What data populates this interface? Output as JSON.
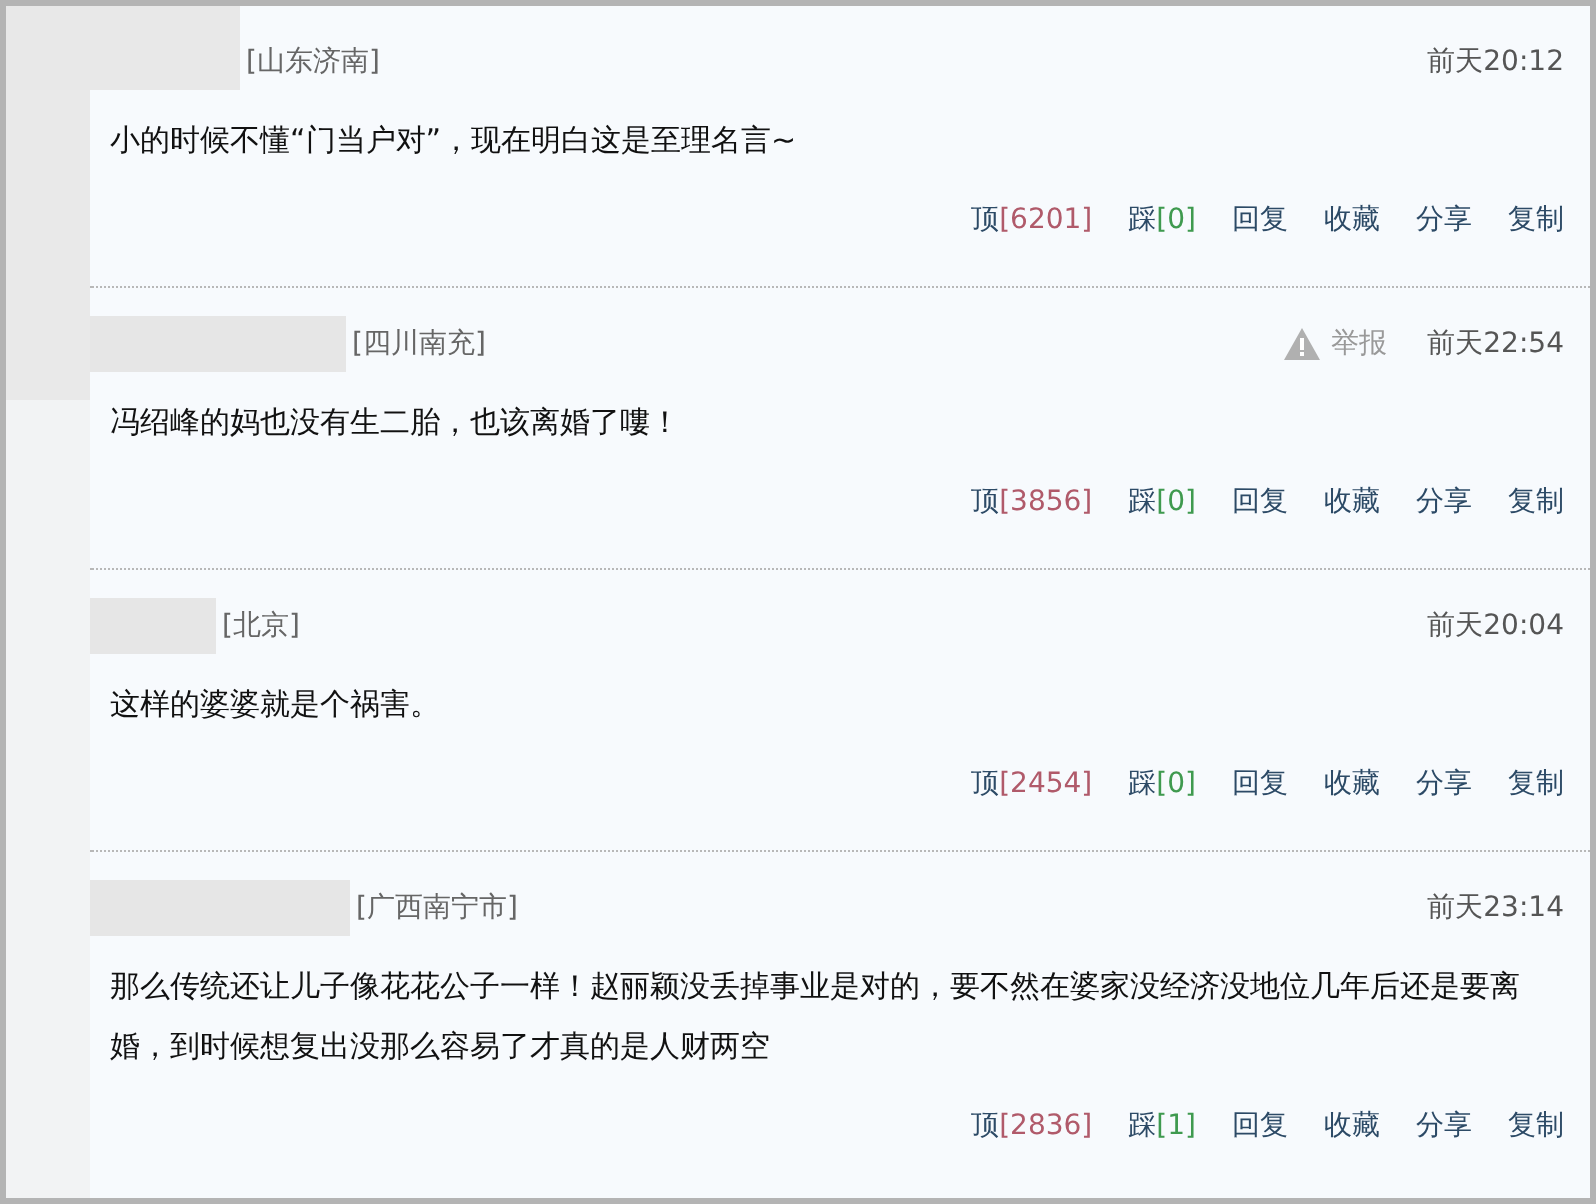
{
  "comments": [
    {
      "location": "[山东济南]",
      "time": "前天20:12",
      "text": "小的时候不懂“门当户对”，现在明白这是至理名言~",
      "actions": [
        {
          "kind": "up",
          "label": "顶",
          "count": "[6201]"
        },
        {
          "kind": "down",
          "label": "踩",
          "count": "[0]"
        },
        {
          "kind": "plain",
          "label": "回复"
        },
        {
          "kind": "plain",
          "label": "收藏"
        },
        {
          "kind": "plain",
          "label": "分享"
        },
        {
          "kind": "plain",
          "label": "复制"
        }
      ]
    },
    {
      "location": "[四川南充]",
      "report": "举报",
      "time": "前天22:54",
      "text": "冯绍峰的妈也没有生二胎，也该离婚了嘍！",
      "actions": [
        {
          "kind": "up",
          "label": "顶",
          "count": "[3856]"
        },
        {
          "kind": "down",
          "label": "踩",
          "count": "[0]"
        },
        {
          "kind": "plain",
          "label": "回复"
        },
        {
          "kind": "plain",
          "label": "收藏"
        },
        {
          "kind": "plain",
          "label": "分享"
        },
        {
          "kind": "plain",
          "label": "复制"
        }
      ]
    },
    {
      "location": "[北京]",
      "time": "前天20:04",
      "text": "这样的婆婆就是个祸害。",
      "actions": [
        {
          "kind": "up",
          "label": "顶",
          "count": "[2454]"
        },
        {
          "kind": "down",
          "label": "踩",
          "count": "[0]"
        },
        {
          "kind": "plain",
          "label": "回复"
        },
        {
          "kind": "plain",
          "label": "收藏"
        },
        {
          "kind": "plain",
          "label": "分享"
        },
        {
          "kind": "plain",
          "label": "复制"
        }
      ]
    },
    {
      "location": "[广西南宁市]",
      "time": "前天23:14",
      "text": "那么传统还让儿子像花花公子一样！赵丽颖没丢掉事业是对的，要不然在婆家没经济没地位几年后还是要离婚，到时候想复出没那么容易了才真的是人财两空",
      "actions": [
        {
          "kind": "up",
          "label": "顶",
          "count": "[2836]"
        },
        {
          "kind": "down",
          "label": "踩",
          "count": "[1]"
        },
        {
          "kind": "plain",
          "label": "回复"
        },
        {
          "kind": "plain",
          "label": "收藏"
        },
        {
          "kind": "plain",
          "label": "分享"
        },
        {
          "kind": "plain",
          "label": "复制"
        }
      ]
    }
  ]
}
